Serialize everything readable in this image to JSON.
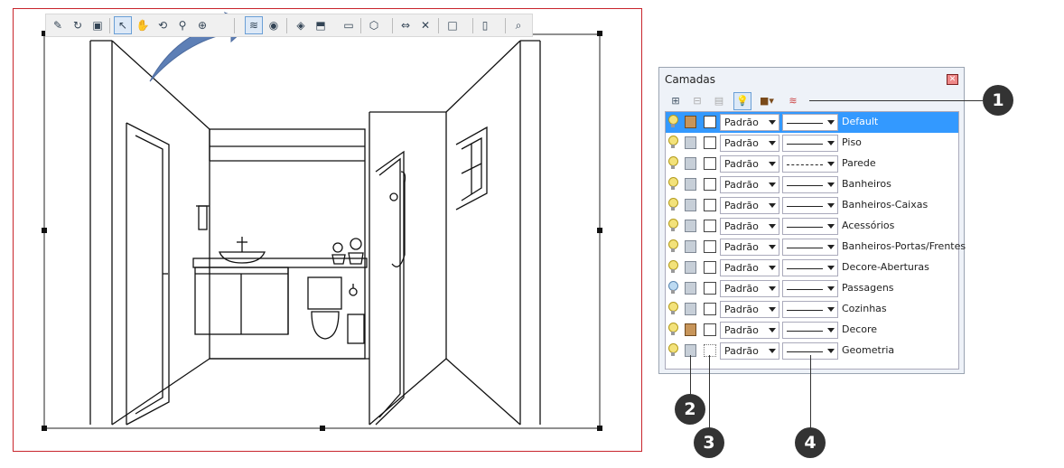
{
  "panel": {
    "title": "Camadas",
    "close_icon": "close-icon",
    "toolbar_icons": [
      "add-layer-icon",
      "delete-layer-icon",
      "layer-details-icon",
      "light-bulb-icon",
      "color-by-layer-icon",
      "purge-layers-icon"
    ],
    "layers": [
      {
        "visible_icon": "light-bulb-icon",
        "cube": "brown",
        "swatch": "white",
        "material": "Padrão",
        "line": "solid",
        "name": "Default",
        "selected": true
      },
      {
        "visible_icon": "light-bulb-icon",
        "cube": "gray",
        "swatch": "white",
        "material": "Padrão",
        "line": "solid",
        "name": "Piso",
        "selected": false
      },
      {
        "visible_icon": "light-bulb-icon",
        "cube": "gray",
        "swatch": "white",
        "material": "Padrão",
        "line": "dashed",
        "name": "Parede",
        "selected": false
      },
      {
        "visible_icon": "light-bulb-icon",
        "cube": "gray",
        "swatch": "white",
        "material": "Padrão",
        "line": "solid",
        "name": "Banheiros",
        "selected": false
      },
      {
        "visible_icon": "light-bulb-icon",
        "cube": "gray",
        "swatch": "white",
        "material": "Padrão",
        "line": "solid",
        "name": "Banheiros-Caixas",
        "selected": false
      },
      {
        "visible_icon": "light-bulb-icon",
        "cube": "gray",
        "swatch": "white",
        "material": "Padrão",
        "line": "solid",
        "name": "Acessórios",
        "selected": false
      },
      {
        "visible_icon": "light-bulb-icon",
        "cube": "gray",
        "swatch": "white",
        "material": "Padrão",
        "line": "solid",
        "name": "Banheiros-Portas/Frentes",
        "selected": false
      },
      {
        "visible_icon": "light-bulb-icon",
        "cube": "gray",
        "swatch": "white",
        "material": "Padrão",
        "line": "solid",
        "name": "Decore-Aberturas",
        "selected": false
      },
      {
        "visible_icon": "light-bulb-blue-icon",
        "cube": "gray",
        "swatch": "white",
        "material": "Padrão",
        "line": "solid",
        "name": "Passagens",
        "selected": false
      },
      {
        "visible_icon": "light-bulb-icon",
        "cube": "gray",
        "swatch": "white",
        "material": "Padrão",
        "line": "solid",
        "name": "Cozinhas",
        "selected": false
      },
      {
        "visible_icon": "light-bulb-icon",
        "cube": "brown",
        "swatch": "white",
        "material": "Padrão",
        "line": "solid",
        "name": "Decore",
        "selected": false
      },
      {
        "visible_icon": "light-bulb-icon",
        "cube": "gray",
        "swatch": "dotted",
        "material": "Padrão",
        "line": "solid",
        "name": "Geometria",
        "selected": false
      }
    ]
  },
  "callouts": [
    "1",
    "2",
    "3",
    "4"
  ],
  "main_toolbar_icons": [
    "edit-icon",
    "refresh-icon",
    "paste-icon",
    "select-arrow-icon",
    "pan-hand-icon",
    "orbit-icon",
    "zoom-icon",
    "zoom-window-icon",
    "layers-icon",
    "eye-icon",
    "styles-icon",
    "section-icon",
    "frame-icon",
    "cube-view-icon",
    "dimension-icon",
    "delete-dimension-icon",
    "color-swatch-icon",
    "door-icon",
    "search-zoom-icon"
  ],
  "colors": {
    "viewport_border": "#c8252c",
    "selected_row": "#3399ff",
    "arrow": "#5d7fb6",
    "callout": "#333333"
  }
}
